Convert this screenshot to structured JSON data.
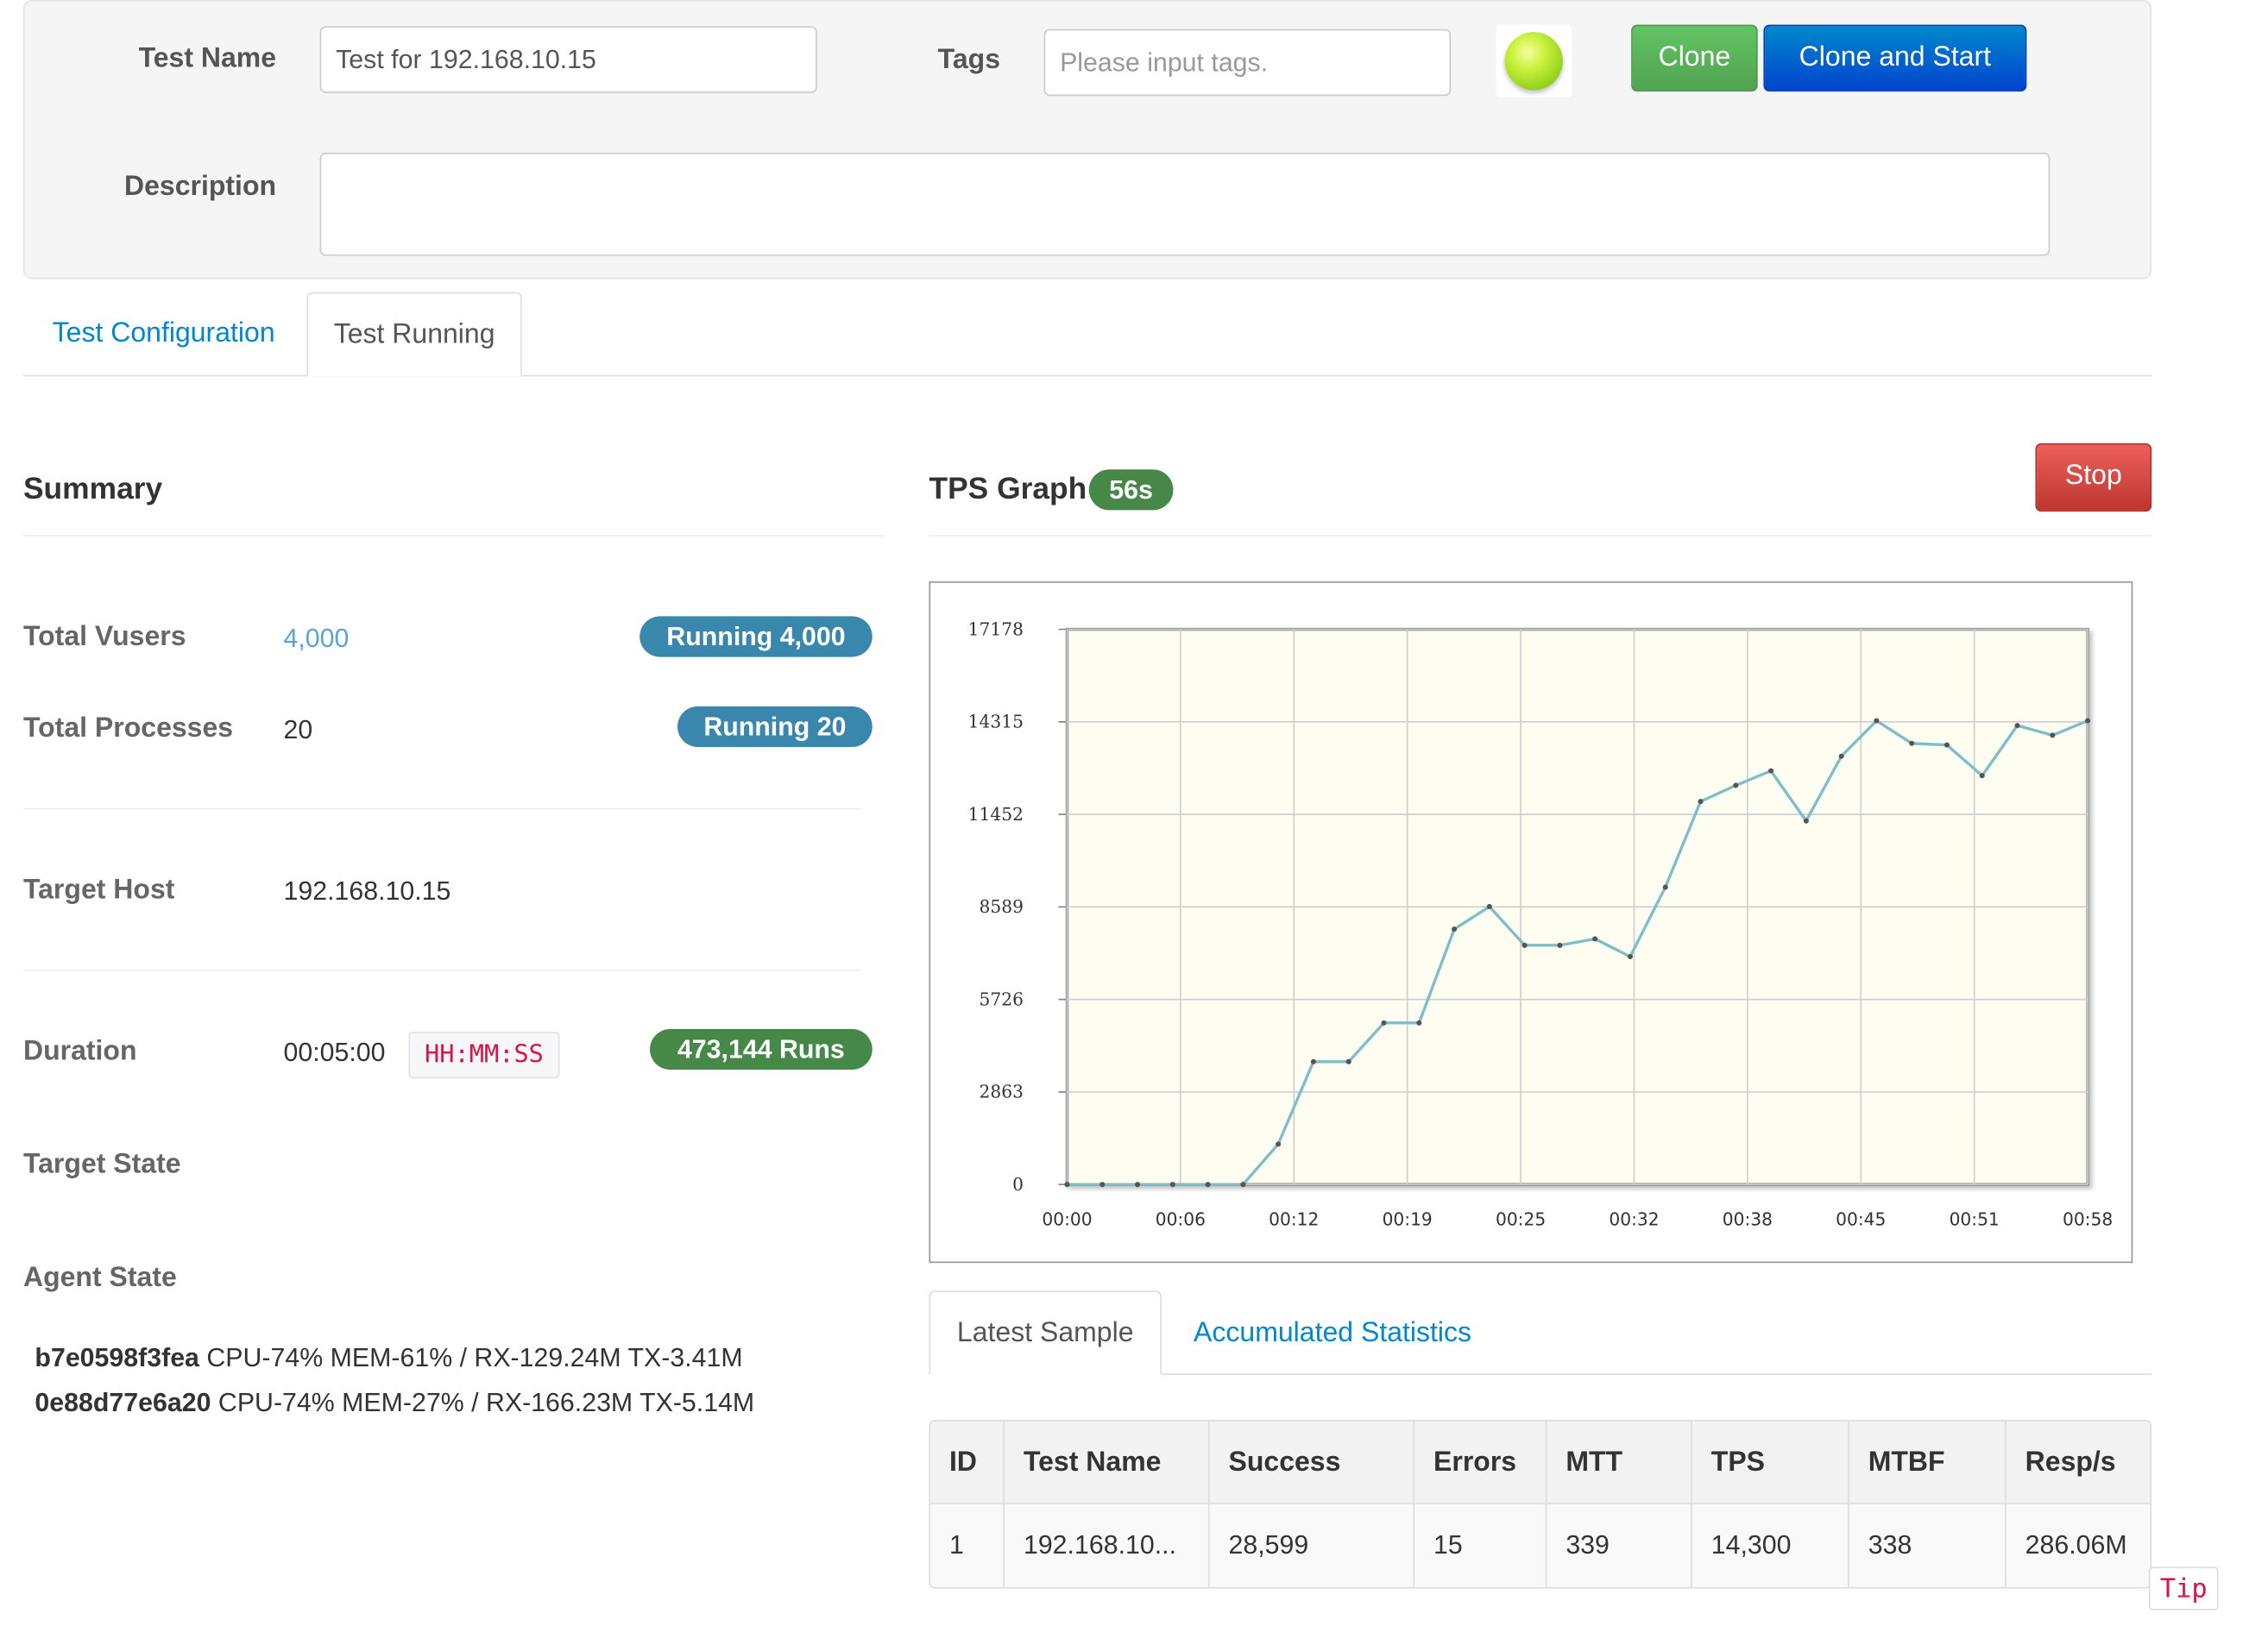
{
  "header": {
    "test_name_label": "Test Name",
    "test_name_value": "Test for 192.168.10.15",
    "tags_label": "Tags",
    "tags_placeholder": "Please input tags.",
    "status_icon": "green-ball-icon",
    "clone_label": "Clone",
    "clone_start_label": "Clone and Start",
    "description_label": "Description",
    "description_value": ""
  },
  "tabs": [
    {
      "label": "Test Configuration",
      "active": false
    },
    {
      "label": "Test Running",
      "active": true
    }
  ],
  "summary": {
    "title": "Summary",
    "total_vusers_label": "Total Vusers",
    "total_vusers_value": "4,000",
    "running_vusers_badge": "Running 4,000",
    "total_processes_label": "Total Processes",
    "total_processes_value": "20",
    "running_processes_badge": "Running 20",
    "target_host_label": "Target Host",
    "target_host_value": "192.168.10.15",
    "duration_label": "Duration",
    "duration_value": "00:05:00",
    "duration_format": "HH:MM:SS",
    "runs_badge": "473,144  Runs",
    "target_state_label": "Target State",
    "agent_state_label": "Agent State",
    "agents": [
      {
        "id": "b7e0598f3fea",
        "stats": "CPU-74% MEM-61% / RX-129.24M TX-3.41M"
      },
      {
        "id": "0e88d77e6a20",
        "stats": "CPU-74% MEM-27% / RX-166.23M TX-5.14M"
      }
    ]
  },
  "graph": {
    "title": "TPS Graph",
    "elapsed_badge": "56s",
    "stop_label": "Stop"
  },
  "chart_data": {
    "type": "line",
    "title": "",
    "xlabel": "",
    "ylabel": "",
    "x_ticks": [
      "00:00",
      "00:06",
      "00:12",
      "00:19",
      "00:25",
      "00:32",
      "00:38",
      "00:45",
      "00:51",
      "00:58"
    ],
    "y_ticks": [
      0,
      2863,
      5726,
      8589,
      11452,
      14315,
      17178
    ],
    "ylim": [
      0,
      17178
    ],
    "xlim_seconds": [
      0,
      58
    ],
    "grid": true,
    "series": [
      {
        "x_seconds": [
          0,
          2,
          4,
          6,
          8,
          10,
          12,
          14,
          16,
          18,
          20,
          22,
          24,
          26,
          28,
          30,
          32,
          34,
          36,
          38,
          40,
          42,
          44,
          46,
          48,
          50,
          52,
          54,
          56,
          58
        ],
        "values": [
          0,
          0,
          0,
          0,
          0,
          0,
          1250,
          3800,
          3800,
          5000,
          5000,
          7900,
          8600,
          7400,
          7400,
          7600,
          7050,
          9200,
          11850,
          12350,
          12800,
          11250,
          13250,
          14350,
          13650,
          13600,
          12650,
          14200,
          13900,
          14350
        ],
        "color": "#7ebfc6"
      }
    ]
  },
  "stats_tabs": [
    {
      "label": "Latest Sample",
      "active": true
    },
    {
      "label": "Accumulated Statistics",
      "active": false
    }
  ],
  "table": {
    "columns": [
      "ID",
      "Test Name",
      "Success",
      "Errors",
      "MTT",
      "TPS",
      "MTBF",
      "Resp/s"
    ],
    "rows": [
      [
        "1",
        "192.168.10...",
        "28,599",
        "15",
        "339",
        "14,300",
        "338",
        "286.06M"
      ]
    ]
  },
  "tip_label": "Tip"
}
